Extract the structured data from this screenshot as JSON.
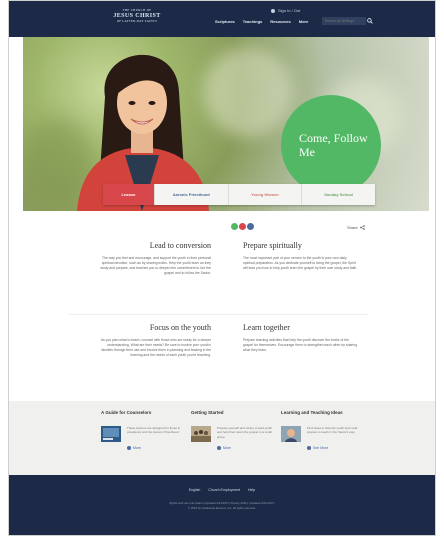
{
  "header": {
    "logo": {
      "line1": "THE CHURCH OF",
      "line2": "JESUS CHRIST",
      "line3": "OF LATTER-DAY SAINTS"
    },
    "sign_in": "Sign In / Out",
    "nav": [
      "Scriptures",
      "Teachings",
      "Resources",
      "More"
    ],
    "search_placeholder": "Search All Biblings"
  },
  "hero": {
    "title": "Come, Follow Me",
    "tabs": [
      "Lesson",
      "Aaronic Priesthood",
      "Young Women",
      "Sunday School"
    ]
  },
  "pager_colors": [
    "#52b866",
    "#d6464a",
    "#4b6a9d"
  ],
  "share_label": "Share",
  "sections": [
    {
      "title": "Lead to conversion",
      "text": "The way you feel and encourage, and support the youth in their personal spiritual devotion, such as by sharing truths. Help the youth learn as they study and prepare, and teaches you to deepen the commitment to live the gospel and to follow the Savior."
    },
    {
      "title": "Prepare spiritually",
      "text": "The most important part of your service to the youth is your own daily spiritual preparation. As you dedicate yourself to living the gospel, the Spirit will lead you how to help youth learn the gospel by their own study and faith."
    },
    {
      "title": "Focus on the youth",
      "text": "As you plan what to teach, counsel with those who are ready for a deeper understanding. What are their needs? Be sure to involve your youth's families through their use and involve them in planning and leading in the learning and the needs of each youth you're teaching."
    },
    {
      "title": "Learn together",
      "text": "Prepare learning activities that help the youth discover the truths of the gospel for themselves. Encourage them to strengthen each other by sharing what they learn."
    }
  ],
  "resources": [
    {
      "title": "A Guide for Counselors",
      "text": "These lessons are designed for those in presidency and the Aaronic Priesthood.",
      "link": "More"
    },
    {
      "title": "Getting Started",
      "text": "Prepare yourself and others to lead youth and help them learn the gospel in a small group.",
      "link": "More"
    },
    {
      "title": "Learning and Teaching Ideas",
      "text": "Find ideas to help the youth learn and prepare to teach in the Savior's way.",
      "link": "See More"
    }
  ],
  "footer": {
    "links": [
      "English",
      "Church Employment",
      "Help"
    ],
    "copyright_line1": "Rights and Use Information (Updated 2/21/2017)  Privacy Policy (Updated 2/21/2017)",
    "copyright_line2": "© 2018 by Intellectual Reserve, Inc. All rights reserved."
  }
}
